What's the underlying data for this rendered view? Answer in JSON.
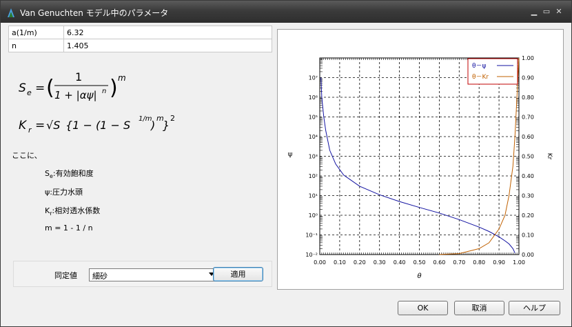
{
  "window": {
    "title": "Van Genuchten モデル中のパラメータ"
  },
  "params": [
    {
      "name": "a(1/m)",
      "value": "6.32"
    },
    {
      "name": "n",
      "value": "1.405"
    }
  ],
  "formula": {
    "se_lhs": "S",
    "se_sub": "e",
    "eq": "=",
    "one": "1",
    "denom": "1 + |αψ|",
    "denom_exp": "n",
    "m": "m",
    "kr_lhs": "K",
    "kr_sub": "r",
    "kr_rhs_a": "√S",
    "kr_rhs_b": "{1 − (1 − S",
    "kr_rhs_c": "1/m",
    "kr_rhs_d": ")",
    "kr_rhs_e": "}",
    "two": "2"
  },
  "explanation": {
    "intro": "ここに、",
    "se_sym": "S",
    "se_sub": "e",
    "se_text": ":有効飽和度",
    "psi_text": "ψ:圧力水頭",
    "kr_sym": "K",
    "kr_sub": "r",
    "kr_text": ":相対透水係数",
    "m_text": "m = 1 - 1 / n"
  },
  "controls": {
    "dt_label": "同定値",
    "combo_value": "細砂",
    "apply": "適用",
    "ok": "OK",
    "cancel": "取消",
    "help": "ヘルプ"
  },
  "chart_data": {
    "type": "line",
    "xlabel": "θ",
    "ylabel_left": "ψ",
    "ylabel_right": "Kr",
    "x_ticks": [
      "0.00",
      "0.10",
      "0.20",
      "0.30",
      "0.40",
      "0.50",
      "0.60",
      "0.70",
      "0.80",
      "0.90",
      "1.00"
    ],
    "y_left_ticks": [
      "10⁻²",
      "10⁻¹",
      "10⁰",
      "10¹",
      "10²",
      "10³",
      "10⁴",
      "10⁵",
      "10⁶",
      "10⁷"
    ],
    "y_left_exponents": [
      -2,
      -1,
      0,
      1,
      2,
      3,
      4,
      5,
      6,
      7
    ],
    "y_right_ticks": [
      "0.00",
      "0.10",
      "0.20",
      "0.30",
      "0.40",
      "0.50",
      "0.60",
      "0.70",
      "0.80",
      "0.90",
      "1.00"
    ],
    "xlim": [
      0,
      1
    ],
    "ylim_left_log10": [
      -2,
      8
    ],
    "ylim_right": [
      0,
      1
    ],
    "grid": true,
    "legend_placement": "top-right",
    "legend": [
      "θ－ψ",
      "θ－Kr"
    ],
    "series": [
      {
        "name": "θ－ψ",
        "color": "#1010a0",
        "x": [
          0.006,
          0.01,
          0.02,
          0.03,
          0.05,
          0.08,
          0.12,
          0.2,
          0.3,
          0.4,
          0.5,
          0.6,
          0.7,
          0.8,
          0.85,
          0.9,
          0.93,
          0.95,
          0.97,
          0.98
        ],
        "y": [
          10000000,
          1000000,
          100000,
          20000,
          2000,
          400,
          110,
          30,
          11,
          5,
          2.5,
          1.3,
          0.6,
          0.25,
          0.15,
          0.08,
          0.05,
          0.035,
          0.02,
          0.012
        ]
      },
      {
        "name": "θ－Kr",
        "color": "#c06000",
        "x": [
          0.6,
          0.7,
          0.8,
          0.85,
          0.9,
          0.93,
          0.95,
          0.97,
          0.98,
          0.99,
          1.0
        ],
        "y": [
          0.0005,
          0.005,
          0.03,
          0.06,
          0.13,
          0.2,
          0.3,
          0.45,
          0.6,
          0.8,
          1.0
        ]
      }
    ]
  }
}
